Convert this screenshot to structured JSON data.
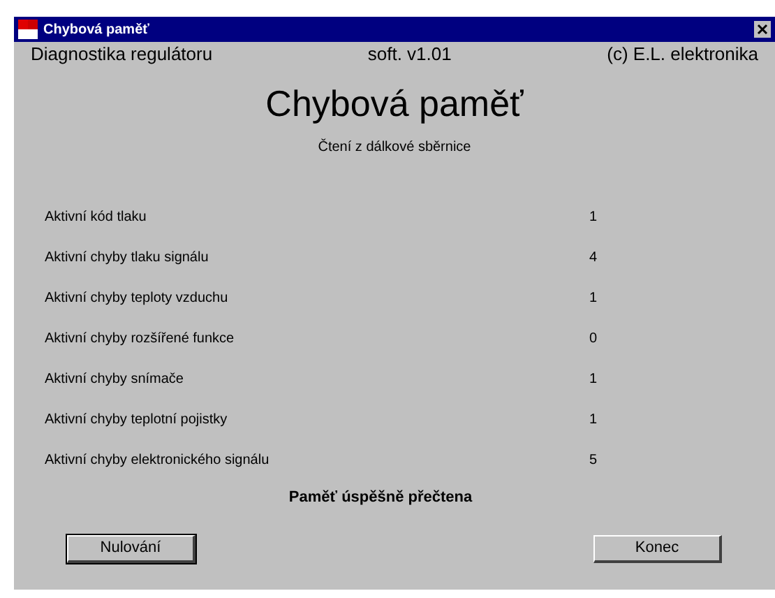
{
  "window": {
    "title": "Chybová paměť"
  },
  "header": {
    "left": "Diagnostika regulátoru",
    "center": "soft. v1.01",
    "right": "(c) E.L. elektronika"
  },
  "heading": "Chybová paměť",
  "subtitle": "Čtení z dálkové sběrnice",
  "rows": [
    {
      "label": "Aktivní kód tlaku",
      "value": "1"
    },
    {
      "label": "Aktivní chyby tlaku signálu",
      "value": "4"
    },
    {
      "label": "Aktivní chyby teploty vzduchu",
      "value": "1"
    },
    {
      "label": "Aktivní chyby rozšířené funkce",
      "value": "0"
    },
    {
      "label": "Aktivní chyby snímače",
      "value": "1"
    },
    {
      "label": "Aktivní chyby teplotní pojistky",
      "value": "1"
    },
    {
      "label": "Aktivní chyby elektronického signálu",
      "value": "5"
    }
  ],
  "status": "Paměť úspěšně přečtena",
  "buttons": [
    {
      "label": "Nulování",
      "focused": true
    },
    {
      "label": "Konec",
      "focused": false
    }
  ]
}
